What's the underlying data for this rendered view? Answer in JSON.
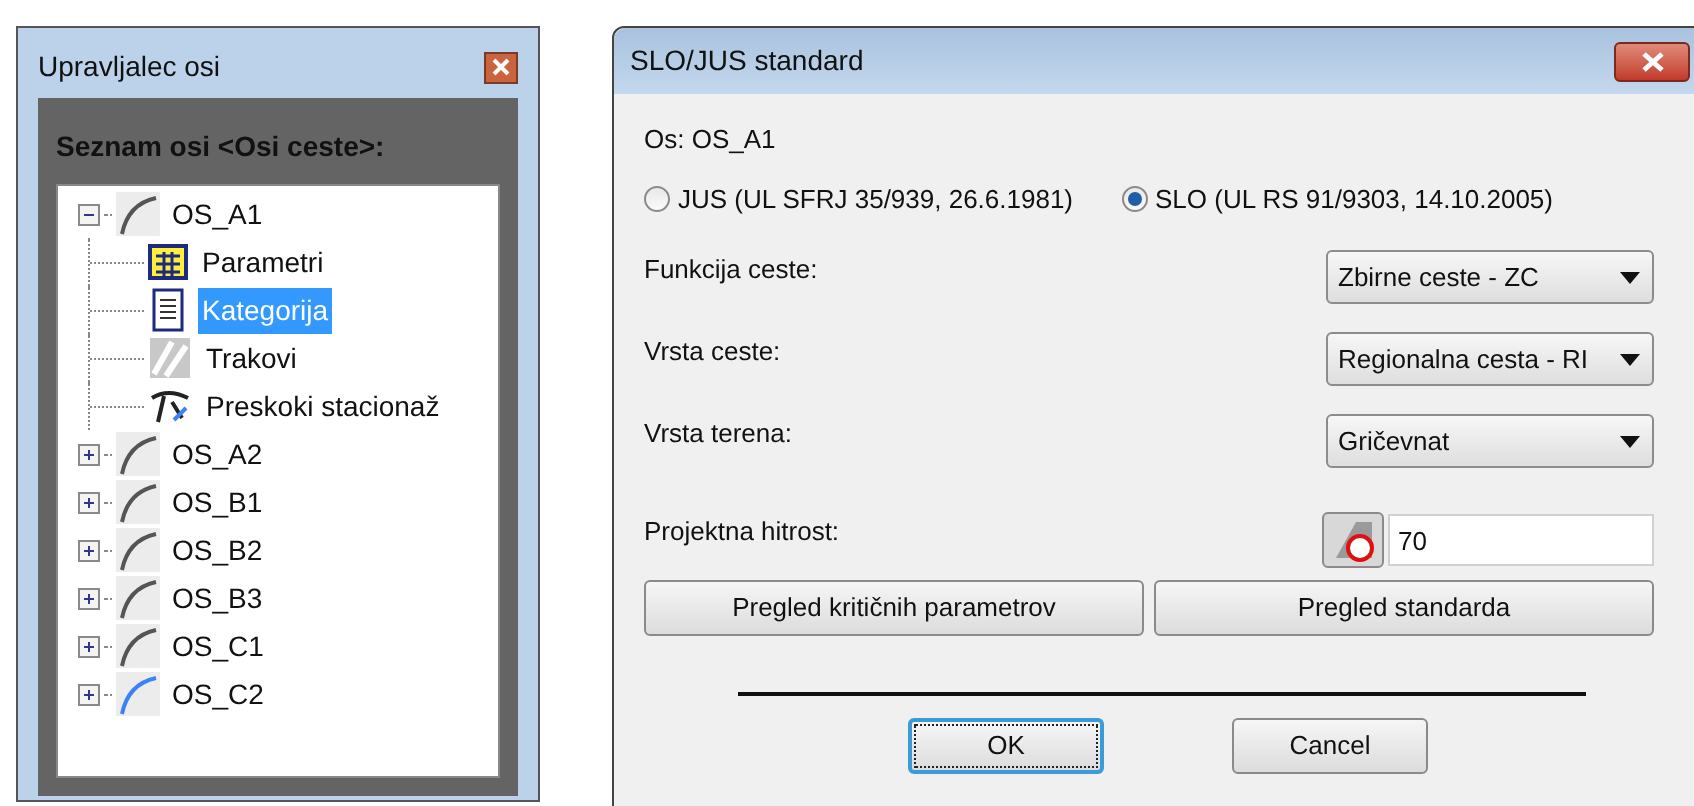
{
  "axis_manager": {
    "title": "Upravljalec osi",
    "list_label": "Seznam osi <Osi ceste>:",
    "tree": [
      {
        "label": "OS_A1",
        "expanded": true,
        "current": false,
        "children": [
          {
            "label": "Parametri",
            "kind": "table",
            "selected": false
          },
          {
            "label": "Kategorija",
            "kind": "document",
            "selected": true
          },
          {
            "label": "Trakovi",
            "kind": "lanes",
            "selected": false
          },
          {
            "label": "Preskoki stacionaž",
            "kind": "jump",
            "selected": false
          }
        ]
      },
      {
        "label": "OS_A2",
        "expanded": false,
        "current": false
      },
      {
        "label": "OS_B1",
        "expanded": false,
        "current": false
      },
      {
        "label": "OS_B2",
        "expanded": false,
        "current": false
      },
      {
        "label": "OS_B3",
        "expanded": false,
        "current": false
      },
      {
        "label": "OS_C1",
        "expanded": false,
        "current": false
      },
      {
        "label": "OS_C2",
        "expanded": false,
        "current": true
      }
    ]
  },
  "dialog": {
    "title": "SLO/JUS standard",
    "axis": "Os: OS_A1",
    "standards": [
      {
        "label": "JUS (UL SFRJ 35/939, 26.6.1981)",
        "selected": false
      },
      {
        "label": "SLO (UL RS 91/9303, 14.10.2005)",
        "selected": true
      }
    ],
    "fields": [
      {
        "label": "Funkcija ceste:",
        "value": "Zbirne ceste - ZC"
      },
      {
        "label": "Vrsta ceste:",
        "value": "Regionalna cesta - RI"
      },
      {
        "label": "Vrsta terena:",
        "value": "Gričevnat"
      }
    ],
    "speed": {
      "label": "Projektna hitrost:",
      "value": "70"
    },
    "review_buttons": [
      "Pregled kritičnih parametrov",
      "Pregled standarda"
    ],
    "buttons": [
      {
        "label": "OK",
        "focused": true
      },
      {
        "label": "Cancel",
        "focused": false
      }
    ]
  }
}
